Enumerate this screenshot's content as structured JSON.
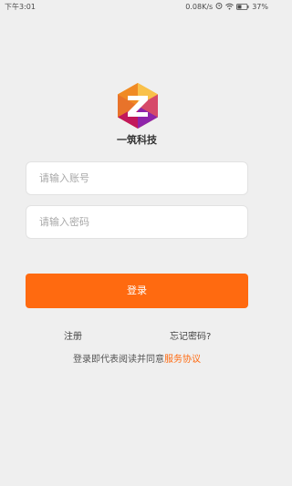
{
  "status_bar": {
    "time": "下午3:01",
    "network_speed": "0.08K/s",
    "battery_percent": "37%"
  },
  "brand": {
    "logo_letter": "Z",
    "name": "一筑科技"
  },
  "form": {
    "account_placeholder": "请输入账号",
    "password_placeholder": "请输入密码",
    "login_label": "登录"
  },
  "links": {
    "register": "注册",
    "forgot_password": "忘记密码?"
  },
  "agreement": {
    "prefix": "登录即代表阅读并同意",
    "link": "服务协议"
  },
  "colors": {
    "accent": "#ff6a10",
    "background": "#efefef"
  }
}
